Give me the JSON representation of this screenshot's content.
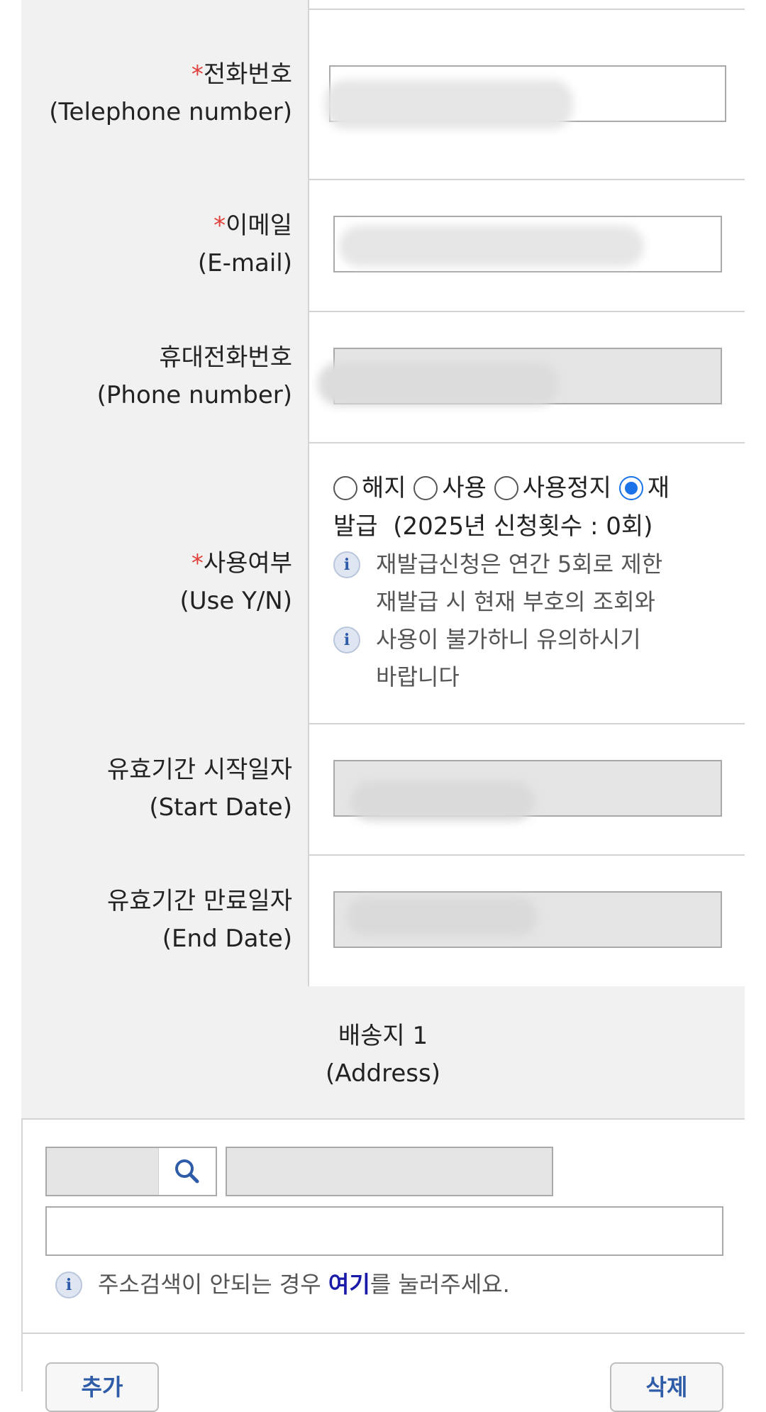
{
  "rows": {
    "telephone": {
      "required_mark": "*",
      "label_ko": "전화번호",
      "label_en": "(Telephone number)"
    },
    "email": {
      "required_mark": "*",
      "label_ko": "이메일",
      "label_en": "(E-mail)"
    },
    "phone": {
      "label_ko": "휴대전화번호",
      "label_en": "(Phone number)"
    },
    "use": {
      "required_mark": "*",
      "label_ko": "사용여부",
      "label_en": "(Use Y/N)",
      "options": [
        "해지",
        "사용",
        "사용정지",
        "재"
      ],
      "options_wrap": "발급",
      "selected": "재발급",
      "count_text": "(2025년 신청횟수 : 0회)",
      "notes": [
        "재발급신청은 연간 5회로 제한",
        "재발급 시 현재 부호의 조회와",
        "사용이 불가하니 유의하시기",
        "바랍니다"
      ]
    },
    "start_date": {
      "label_ko": "유효기간 시작일자",
      "label_en": "(Start Date)"
    },
    "end_date": {
      "label_ko": "유효기간 만료일자",
      "label_en": "(End Date)"
    }
  },
  "address": {
    "title_ko": "배송지 1",
    "title_en": "(Address)",
    "note_prefix": "주소검색이 안되는 경우 ",
    "note_link": "여기",
    "note_suffix": "를 눌러주세요."
  },
  "buttons": {
    "add": "추가",
    "delete": "삭제"
  },
  "colors": {
    "required": "#e0403a",
    "link": "#1a1aa8",
    "radio_selected": "#1a73e8"
  }
}
